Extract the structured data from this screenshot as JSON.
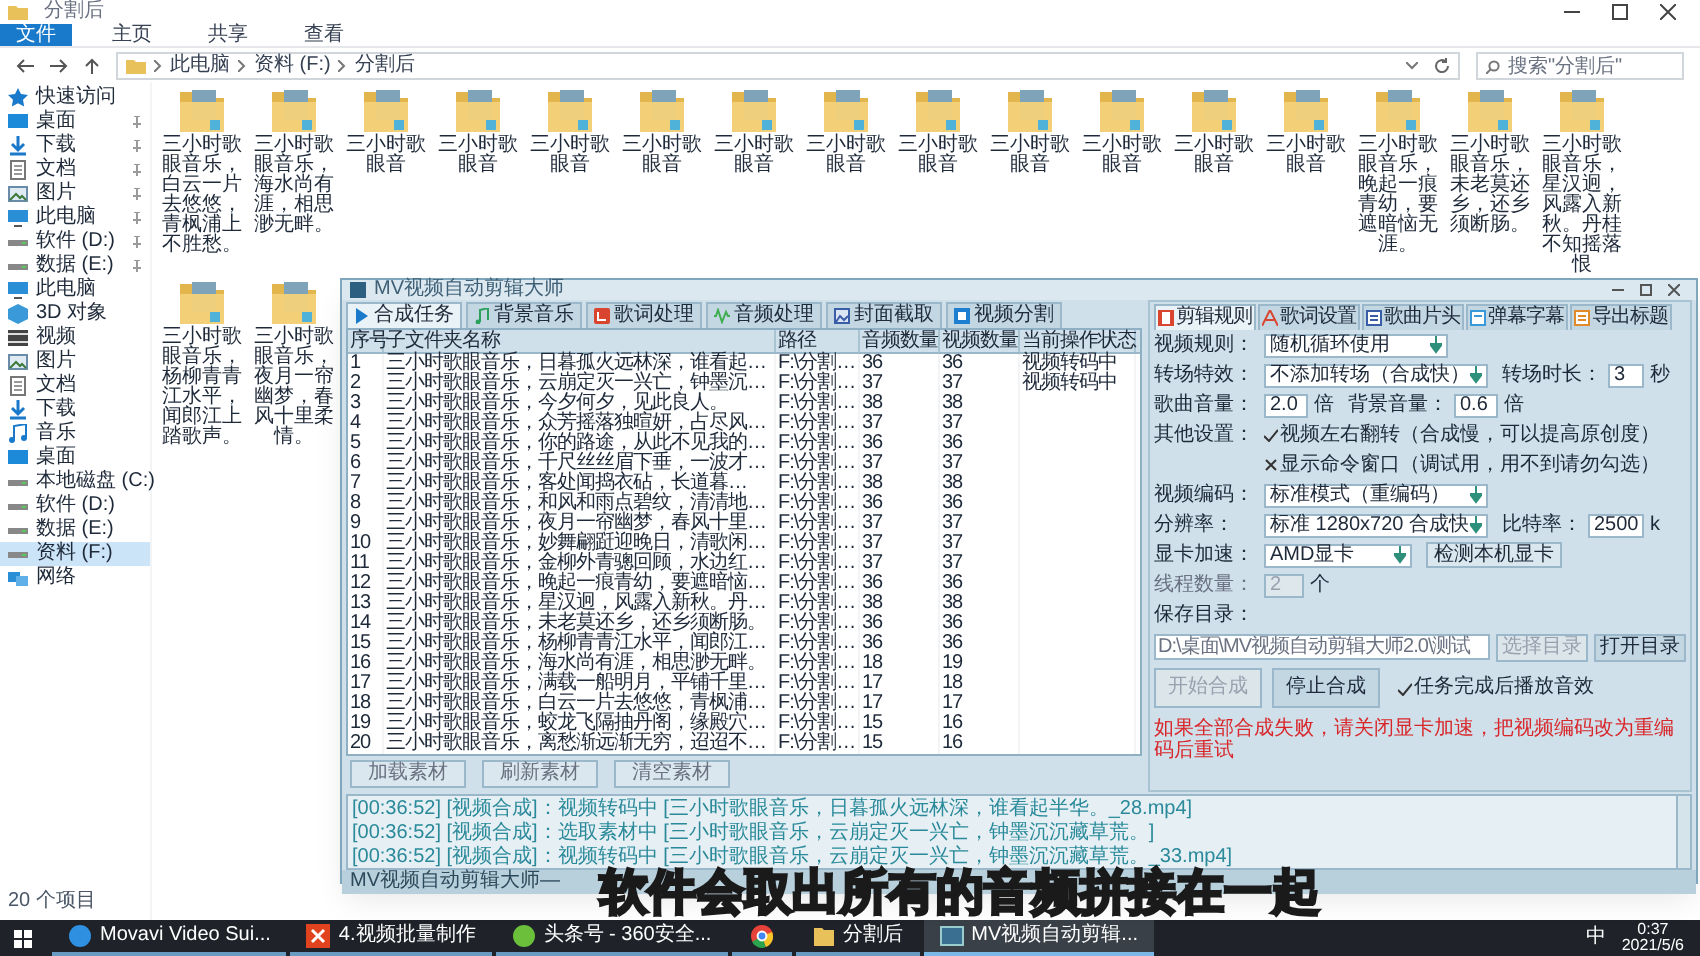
{
  "explorer": {
    "title": "分割后",
    "ribbon_tabs": [
      {
        "label": "文件",
        "selected": true
      },
      {
        "label": "主页",
        "selected": false
      },
      {
        "label": "共享",
        "selected": false
      },
      {
        "label": "查看",
        "selected": false
      }
    ],
    "breadcrumb": [
      "此电脑",
      "资料 (F:)",
      "分割后"
    ],
    "search": {
      "placeholder": "搜索\"分割后\""
    },
    "nav": [
      {
        "label": "快速访问",
        "kind": "star",
        "pinned": false,
        "selected": false
      },
      {
        "label": "桌面",
        "kind": "desktop",
        "pinned": true,
        "selected": false
      },
      {
        "label": "下载",
        "kind": "download",
        "pinned": true,
        "selected": false
      },
      {
        "label": "文档",
        "kind": "doc",
        "pinned": true,
        "selected": false
      },
      {
        "label": "图片",
        "kind": "picture",
        "pinned": true,
        "selected": false
      },
      {
        "label": "此电脑",
        "kind": "pc",
        "pinned": true,
        "selected": false
      },
      {
        "label": "软件 (D:)",
        "kind": "drive",
        "pinned": true,
        "selected": false
      },
      {
        "label": "数据 (E:)",
        "kind": "drive",
        "pinned": true,
        "selected": false
      },
      {
        "label": "此电脑",
        "kind": "pc",
        "pinned": false,
        "selected": false
      },
      {
        "label": "3D 对象",
        "kind": "cube",
        "pinned": false,
        "selected": false
      },
      {
        "label": "视频",
        "kind": "video",
        "pinned": false,
        "selected": false
      },
      {
        "label": "图片",
        "kind": "picture",
        "pinned": false,
        "selected": false
      },
      {
        "label": "文档",
        "kind": "doc",
        "pinned": false,
        "selected": false
      },
      {
        "label": "下载",
        "kind": "download",
        "pinned": false,
        "selected": false
      },
      {
        "label": "音乐",
        "kind": "music",
        "pinned": false,
        "selected": false
      },
      {
        "label": "桌面",
        "kind": "desktop",
        "pinned": false,
        "selected": false
      },
      {
        "label": "本地磁盘 (C:)",
        "kind": "drive",
        "pinned": false,
        "selected": false
      },
      {
        "label": "软件 (D:)",
        "kind": "drive",
        "pinned": false,
        "selected": false
      },
      {
        "label": "数据 (E:)",
        "kind": "drive",
        "pinned": false,
        "selected": false
      },
      {
        "label": "资料 (F:)",
        "kind": "drive",
        "pinned": false,
        "selected": true
      },
      {
        "label": "网络",
        "kind": "network",
        "pinned": false,
        "selected": false
      }
    ],
    "folders_row_1": [
      "三小时歌眼音乐，白云一片去悠悠，青枫浦上不胜愁。",
      "三小时歌眼音乐，海水尚有涯，相思渺无畔。",
      "三小时歌眼音",
      "三小时歌眼音",
      "三小时歌眼音",
      "三小时歌眼音",
      "三小时歌眼音",
      "三小时歌眼音",
      "三小时歌眼音",
      "三小时歌眼音",
      "三小时歌眼音",
      "三小时歌眼音",
      "三小时歌眼音",
      "三小时歌眼音乐，晚起一痕青幼，要遮暗恼无涯。",
      "三小时歌眼音乐，未老莫还乡，还乡须断肠。",
      "三小时歌眼音乐，星汉迥，风露入新秋。丹桂不知摇落恨"
    ],
    "folders_row_2": [
      "三小时歌眼音乐，杨柳青青江水平，闻郎江上踏歌声。",
      "三小时歌眼音乐，夜月一帘幽梦，春风十里柔情。"
    ],
    "status": "20 个项目"
  },
  "app": {
    "title": "MV视频自动剪辑大师",
    "tabs": [
      {
        "label": "合成任务",
        "selected": true
      },
      {
        "label": "背景音乐",
        "selected": false
      },
      {
        "label": "歌词处理",
        "selected": false
      },
      {
        "label": "音频处理",
        "selected": false
      },
      {
        "label": "封面截取",
        "selected": false
      },
      {
        "label": "视频分割",
        "selected": false
      }
    ],
    "table": {
      "columns": [
        "序号",
        "子文件夹名称",
        "路径",
        "音频数量",
        "视频数量",
        "当前操作状态"
      ],
      "rows": [
        [
          "1",
          "三小时歌眼音乐，日暮孤火远林深，谁看起…",
          "F:\\分割…",
          "36",
          "36",
          "视频转码中"
        ],
        [
          "2",
          "三小时歌眼音乐，云崩定灭一兴亡，钟墨沉…",
          "F:\\分割…",
          "37",
          "37",
          "视频转码中"
        ],
        [
          "3",
          "三小时歌眼音乐，今夕何夕，见此良人。",
          "F:\\分割…",
          "38",
          "38"
        ],
        [
          "4",
          "三小时歌眼音乐，众芳摇落独暄妍，占尽风…",
          "F:\\分割…",
          "37",
          "37"
        ],
        [
          "5",
          "三小时歌眼音乐，你的路途，从此不见我的…",
          "F:\\分割…",
          "36",
          "36"
        ],
        [
          "6",
          "三小时歌眼音乐，千尺丝丝眉下垂，一波才…",
          "F:\\分割…",
          "37",
          "37"
        ],
        [
          "7",
          "三小时歌眼音乐，客处闻捣衣砧，长道暮…",
          "F:\\分割…",
          "38",
          "38"
        ],
        [
          "8",
          "三小时歌眼音乐，和风和雨点碧纹，清清地…",
          "F:\\分割…",
          "36",
          "36"
        ],
        [
          "9",
          "三小时歌眼音乐，夜月一帘幽梦，春风十里…",
          "F:\\分割…",
          "37",
          "37"
        ],
        [
          "10",
          "三小时歌眼音乐，妙舞翩跹迎晚日，清歌闲…",
          "F:\\分割…",
          "37",
          "37"
        ],
        [
          "11",
          "三小时歌眼音乐，金柳外青骢回顾，水边红…",
          "F:\\分割…",
          "37",
          "37"
        ],
        [
          "12",
          "三小时歌眼音乐，晚起一痕青幼，要遮暗恼…",
          "F:\\分割…",
          "36",
          "36"
        ],
        [
          "13",
          "三小时歌眼音乐，星汉迥，风露入新秋。丹…",
          "F:\\分割…",
          "38",
          "38"
        ],
        [
          "14",
          "三小时歌眼音乐，未老莫还乡，还乡须断肠。",
          "F:\\分割…",
          "36",
          "36"
        ],
        [
          "15",
          "三小时歌眼音乐，杨柳青青江水平，闻郎江…",
          "F:\\分割…",
          "36",
          "36"
        ],
        [
          "16",
          "三小时歌眼音乐，海水尚有涯，相思渺无畔。",
          "F:\\分割…",
          "18",
          "19"
        ],
        [
          "17",
          "三小时歌眼音乐，满载一船明月，平铺千里…",
          "F:\\分割…",
          "17",
          "18"
        ],
        [
          "18",
          "三小时歌眼音乐，白云一片去悠悠，青枫浦…",
          "F:\\分割…",
          "17",
          "17"
        ],
        [
          "19",
          "三小时歌眼音乐，蛟龙飞隔抽丹阁，缘殿穴…",
          "F:\\分割…",
          "15",
          "16"
        ],
        [
          "20",
          "三小时歌眼音乐，离愁渐远渐无穷，迢迢不…",
          "F:\\分割…",
          "15",
          "16"
        ]
      ]
    },
    "table_buttons": [
      "加载素材",
      "刷新素材",
      "清空素材"
    ],
    "settings": {
      "tabs": [
        {
          "label": "剪辑规则",
          "selected": true
        },
        {
          "label": "歌词设置",
          "selected": false
        },
        {
          "label": "歌曲片头",
          "selected": false
        },
        {
          "label": "弹幕字幕",
          "selected": false
        },
        {
          "label": "导出标题",
          "selected": false
        }
      ],
      "video_rule": {
        "label": "视频规则：",
        "value": "随机循环使用"
      },
      "transition": {
        "label": "转场特效：",
        "value": "不添加转场（合成快）",
        "duration_label": "转场时长：",
        "duration": "3",
        "unit": "秒"
      },
      "volume": {
        "label": "歌曲音量：",
        "value": "2.0",
        "unit": "倍",
        "bg_label": "背景音量：",
        "bg_value": "0.6",
        "bg_unit": "倍"
      },
      "options_label": "其他设置：",
      "options": [
        {
          "label": "视频左右翻转（合成慢，可以提高原创度）",
          "checked": true
        },
        {
          "label": "显示命令窗口（调试用，用不到请勿勾选）",
          "checked": false
        }
      ],
      "encoding": {
        "label": "视频编码：",
        "value": "标准模式（重编码）"
      },
      "resolution": {
        "label": "分辨率：",
        "value": "标准 1280x720 合成快",
        "bitrate_label": "比特率：",
        "bitrate": "2500",
        "unit": "k"
      },
      "gpu": {
        "label": "显卡加速：",
        "value": "AMD显卡",
        "button": "检测本机显卡"
      },
      "threads": {
        "label": "线程数量：",
        "value": "2",
        "unit": "个",
        "disabled": true
      },
      "save_dir": {
        "label": "保存目录：",
        "path": "D:\\桌面\\MV视频自动剪辑大师2.0\\测试",
        "choose": {
          "label": "选择目录",
          "disabled": true
        },
        "open": {
          "label": "打开目录",
          "disabled": false
        }
      },
      "start": {
        "label": "开始合成",
        "disabled": true
      },
      "stop": {
        "label": "停止合成",
        "disabled": false
      },
      "sound_option": {
        "label": "任务完成后播放音效",
        "checked": true
      },
      "warning": "如果全部合成失败，请关闭显卡加速，把视频编码改为重编码后重试"
    },
    "log": [
      "[00:36:52] [视频合成]：视频转码中 [三小时歌眼音乐，日暮孤火远林深，谁看起半华。_28.mp4]",
      "[00:36:52] [视频合成]：选取素材中 [三小时歌眼音乐，云崩定灭一兴亡，钟墨沉沉藏草荒。]",
      "[00:36:52] [视频合成]：视频转码中 [三小时歌眼音乐，云崩定灭一兴亡，钟墨沉沉藏草荒。_33.mp4]"
    ],
    "status": "MV视频自动剪辑大师—"
  },
  "caption": "软件会取出所有的音频拼接在一起",
  "taskbar": {
    "items": [
      {
        "label": "Movavi Video Sui...",
        "kind": "movavi",
        "active": false
      },
      {
        "label": "4.视频批量制作",
        "kind": "x",
        "active": false
      },
      {
        "label": "头条号 - 360安全...",
        "kind": "browser360",
        "active": false
      },
      {
        "kind": "chrome",
        "active": false
      },
      {
        "label": "分割后",
        "kind": "folder",
        "active": false
      },
      {
        "label": "MV视频自动剪辑...",
        "kind": "app",
        "active": true
      }
    ],
    "ime": "中",
    "time": "0:37",
    "date": "2021/5/6"
  }
}
